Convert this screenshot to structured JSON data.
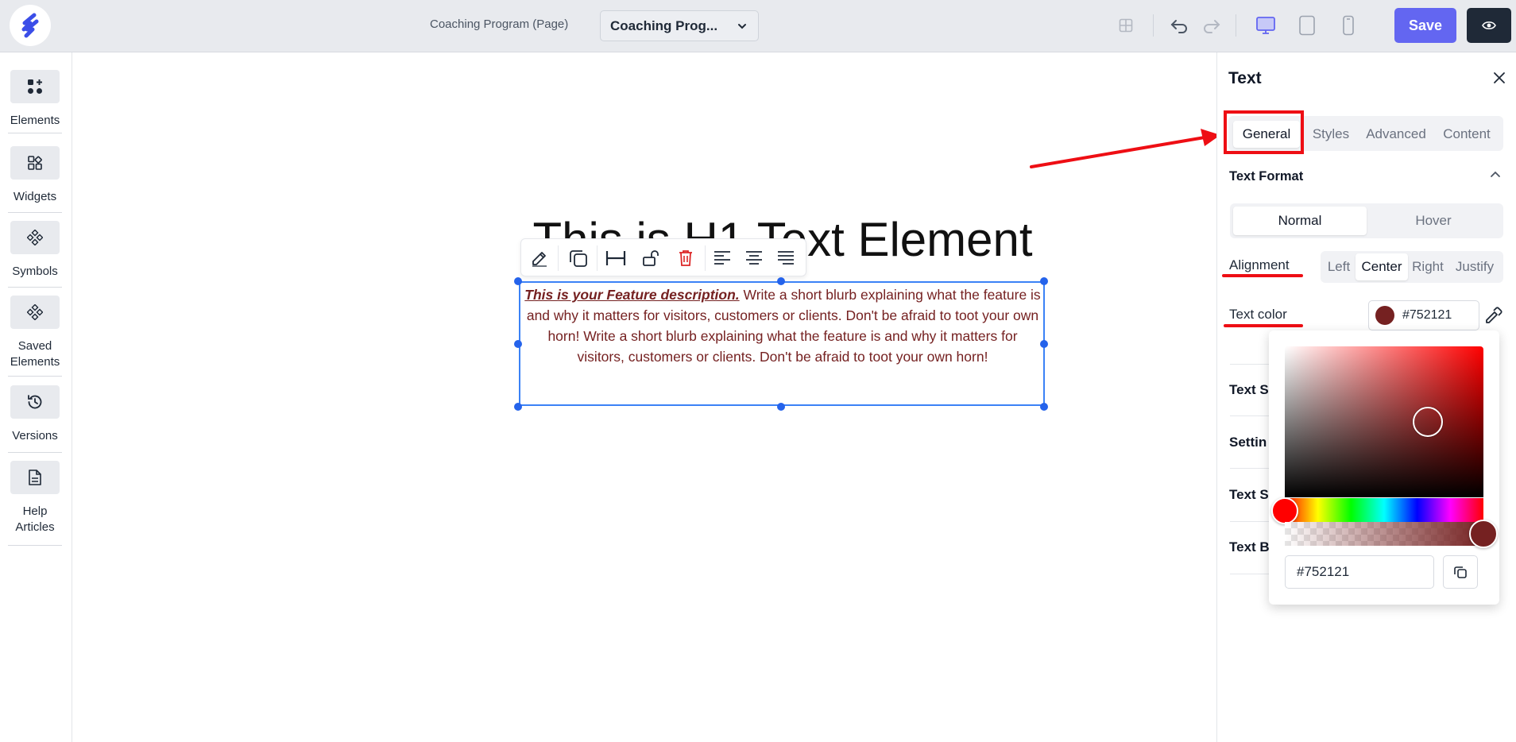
{
  "topbar": {
    "page_title": "Coaching Program (Page)",
    "page_select_value": "Coaching Prog...",
    "save_label": "Save"
  },
  "sidebar": {
    "items": [
      {
        "label": "Elements",
        "icon": "elements-icon"
      },
      {
        "label": "Widgets",
        "icon": "widgets-icon"
      },
      {
        "label": "Symbols",
        "icon": "symbols-icon"
      },
      {
        "label": "Saved Elements",
        "icon": "saved-elements-icon"
      },
      {
        "label": "Versions",
        "icon": "history-icon"
      },
      {
        "label": "Help Articles",
        "icon": "document-icon"
      }
    ]
  },
  "canvas": {
    "h1_text": "This is H1 Text Element",
    "feature_lead": "This is your Feature description.",
    "feature_body": " Write a short blurb explaining what the feature is and why it matters for visitors, customers or clients. Don't be afraid to toot your own horn! Write a short blurb explaining what the feature is and why it matters for visitors, customers or clients. Don't be afraid to toot your own horn!"
  },
  "panel": {
    "title": "Text",
    "tabs": [
      {
        "label": "General",
        "active": true
      },
      {
        "label": "Styles",
        "active": false
      },
      {
        "label": "Advanced",
        "active": false
      },
      {
        "label": "Content",
        "active": false
      }
    ],
    "text_format_title": "Text Format",
    "state_options": [
      {
        "label": "Normal",
        "active": true
      },
      {
        "label": "Hover",
        "active": false
      }
    ],
    "alignment_label": "Alignment",
    "alignment_options": [
      {
        "label": "Left",
        "active": false
      },
      {
        "label": "Center",
        "active": true
      },
      {
        "label": "Right",
        "active": false
      },
      {
        "label": "Justify",
        "active": false
      }
    ],
    "text_color_label": "Text color",
    "text_color_value": "#752121",
    "collapsed_sections": [
      "Text S",
      "Settin",
      "Text S",
      "Text B"
    ]
  },
  "color_picker": {
    "hex_value": "#752121"
  },
  "colors": {
    "accent": "#6366f1",
    "selection": "#3b82f6",
    "annotation_red": "#ee0e14",
    "text_color": "#752121"
  }
}
